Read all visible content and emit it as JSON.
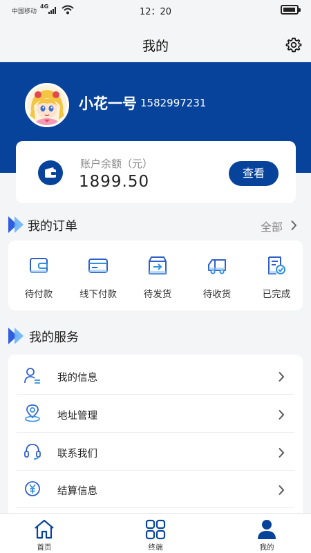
{
  "status_bar": {
    "carrier": "中国移动",
    "network": "4G",
    "time": "12：20"
  },
  "header": {
    "title": "我的",
    "settings_icon": "gear-icon"
  },
  "profile": {
    "username": "小花一号",
    "phone": "1582997231",
    "avatar_icon": "cartoon-avatar"
  },
  "balance": {
    "label": "账户余额（元）",
    "value": "1899.50",
    "button_label": "查看",
    "icon": "wallet-icon"
  },
  "orders": {
    "title": "我的订单",
    "more_label": "全部",
    "items": [
      {
        "label": "待付款",
        "icon": "wallet-card-icon"
      },
      {
        "label": "线下付款",
        "icon": "credit-card-icon"
      },
      {
        "label": "待发货",
        "icon": "box-arrow-icon"
      },
      {
        "label": "待收货",
        "icon": "truck-icon"
      },
      {
        "label": "已完成",
        "icon": "document-check-icon"
      }
    ]
  },
  "services": {
    "title": "我的服务",
    "items": [
      {
        "label": "我的信息",
        "icon": "user-info-icon"
      },
      {
        "label": "地址管理",
        "icon": "location-pin-icon"
      },
      {
        "label": "联系我们",
        "icon": "headset-icon"
      },
      {
        "label": "结算信息",
        "icon": "yen-coin-icon"
      }
    ]
  },
  "tabbar": {
    "items": [
      {
        "label": "首页",
        "icon": "home-icon"
      },
      {
        "label": "终端",
        "icon": "grid-icon"
      },
      {
        "label": "我的",
        "icon": "user-icon",
        "active": true
      }
    ]
  },
  "colors": {
    "primary": "#07439b",
    "accent": "#2f8fe0",
    "background": "#f4f5f7"
  }
}
